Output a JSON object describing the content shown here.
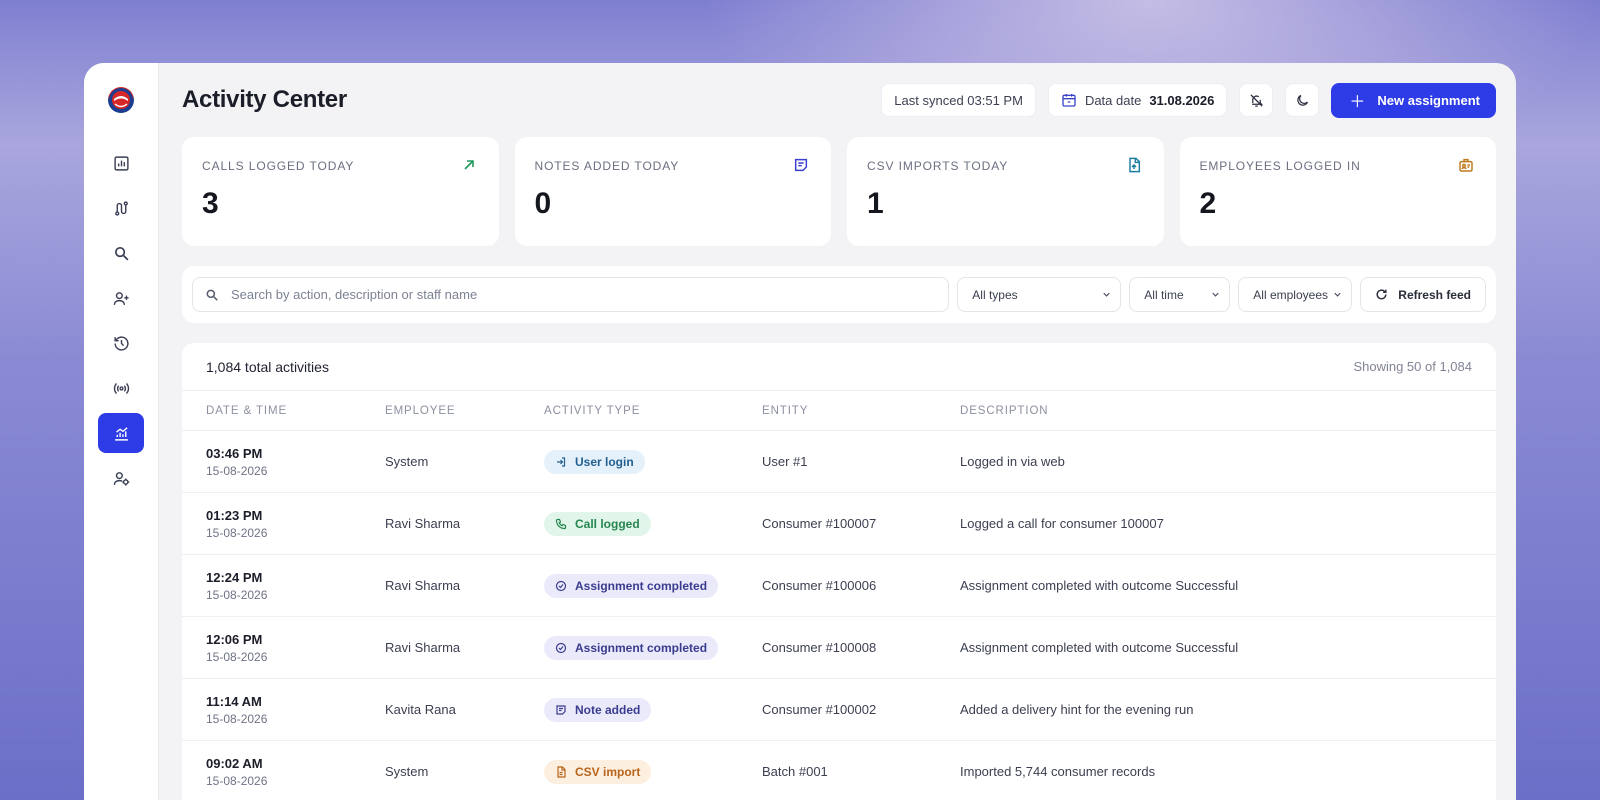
{
  "app": {
    "title": "Activity Center"
  },
  "sidebar": {
    "items": [
      {
        "name": "reports-icon",
        "active": false
      },
      {
        "name": "routes-icon",
        "active": false
      },
      {
        "name": "search-icon",
        "active": false
      },
      {
        "name": "add-user-icon",
        "active": false
      },
      {
        "name": "history-icon",
        "active": false
      },
      {
        "name": "broadcast-icon",
        "active": false
      },
      {
        "name": "activity-icon",
        "active": true
      },
      {
        "name": "user-settings-icon",
        "active": false
      }
    ]
  },
  "topbar": {
    "last_synced": "Last synced 03:51 PM",
    "data_date_label": "Data date",
    "data_date_value": "31.08.2026",
    "new_assignment_label": "New assignment"
  },
  "stats": [
    {
      "label": "Calls logged today",
      "value": "3",
      "icon": "trend-up-icon",
      "color": "#1f9a5a"
    },
    {
      "label": "Notes added today",
      "value": "0",
      "icon": "note-icon",
      "color": "#3b3fd0"
    },
    {
      "label": "CSV imports today",
      "value": "1",
      "icon": "file-upload-icon",
      "color": "#1c7fa0"
    },
    {
      "label": "Employees logged in",
      "value": "2",
      "icon": "badge-icon",
      "color": "#c07a1f"
    }
  ],
  "filters": {
    "search_placeholder": "Search by action, description or staff name",
    "type": "All types",
    "time": "All time",
    "employee": "All employees",
    "refresh_label": "Refresh feed"
  },
  "table": {
    "total": "1,084 total activities",
    "showing": "Showing 50 of 1,084",
    "columns": [
      "Date & Time",
      "Employee",
      "Activity Type",
      "Entity",
      "Description"
    ],
    "rows": [
      {
        "time": "03:46 PM",
        "date": "15-08-2026",
        "employee": "System",
        "type": "User login",
        "kind": "login",
        "entity": "User #1",
        "description": "Logged in via web"
      },
      {
        "time": "01:23 PM",
        "date": "15-08-2026",
        "employee": "Ravi Sharma",
        "type": "Call logged",
        "kind": "call",
        "entity": "Consumer #100007",
        "description": "Logged a call for consumer 100007"
      },
      {
        "time": "12:24 PM",
        "date": "15-08-2026",
        "employee": "Ravi Sharma",
        "type": "Assignment completed",
        "kind": "assign",
        "entity": "Consumer #100006",
        "description": "Assignment completed with outcome Successful"
      },
      {
        "time": "12:06 PM",
        "date": "15-08-2026",
        "employee": "Ravi Sharma",
        "type": "Assignment completed",
        "kind": "assign",
        "entity": "Consumer #100008",
        "description": "Assignment completed with outcome Successful"
      },
      {
        "time": "11:14 AM",
        "date": "15-08-2026",
        "employee": "Kavita Rana",
        "type": "Note added",
        "kind": "note",
        "entity": "Consumer #100002",
        "description": "Added a delivery hint for the evening run"
      },
      {
        "time": "09:02 AM",
        "date": "15-08-2026",
        "employee": "System",
        "type": "CSV import",
        "kind": "csv",
        "entity": "Batch #001",
        "description": "Imported 5,744 consumer records"
      }
    ]
  }
}
